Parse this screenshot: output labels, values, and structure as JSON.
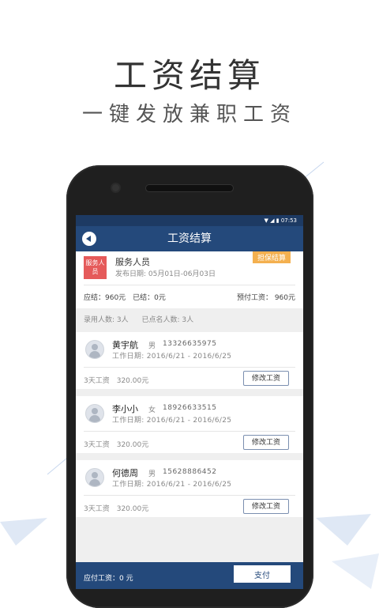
{
  "hero": {
    "title": "工资结算",
    "subtitle": "一键发放兼职工资"
  },
  "status_bar": {
    "time": "07:53"
  },
  "nav": {
    "title": "工资结算"
  },
  "summary": {
    "tag": "服务人员",
    "name": "服务人员",
    "publish_date": "发布日期: 05月01日-06月03日",
    "badge": "担保结算",
    "settled": "应结：960元　已结：0元",
    "prepay": "预付工资： 960元"
  },
  "counts": {
    "hired": "录用人数: 3人",
    "checked": "已点名人数: 3人"
  },
  "workers": [
    {
      "name": "黄宇航",
      "gender": "男",
      "phone": "13326635975",
      "work_date": "工作日期: 2016/6/21 - 2016/6/25",
      "pay": "3天工资　320.00元",
      "edit_label": "修改工资"
    },
    {
      "name": "李小小",
      "gender": "女",
      "phone": "18926633515",
      "work_date": "工作日期: 2016/6/21 - 2016/6/25",
      "pay": "3天工资　320.00元",
      "edit_label": "修改工资"
    },
    {
      "name": "何德周",
      "gender": "男",
      "phone": "15628886452",
      "work_date": "工作日期: 2016/6/21 - 2016/6/25",
      "pay": "3天工资　320.00元",
      "edit_label": "修改工资"
    }
  ],
  "footer": {
    "due_label": "应付工资：0 元",
    "pay_label": "支付"
  },
  "colors": {
    "primary": "#24497b",
    "tag": "#e55a5a",
    "badge": "#f4b04f"
  }
}
